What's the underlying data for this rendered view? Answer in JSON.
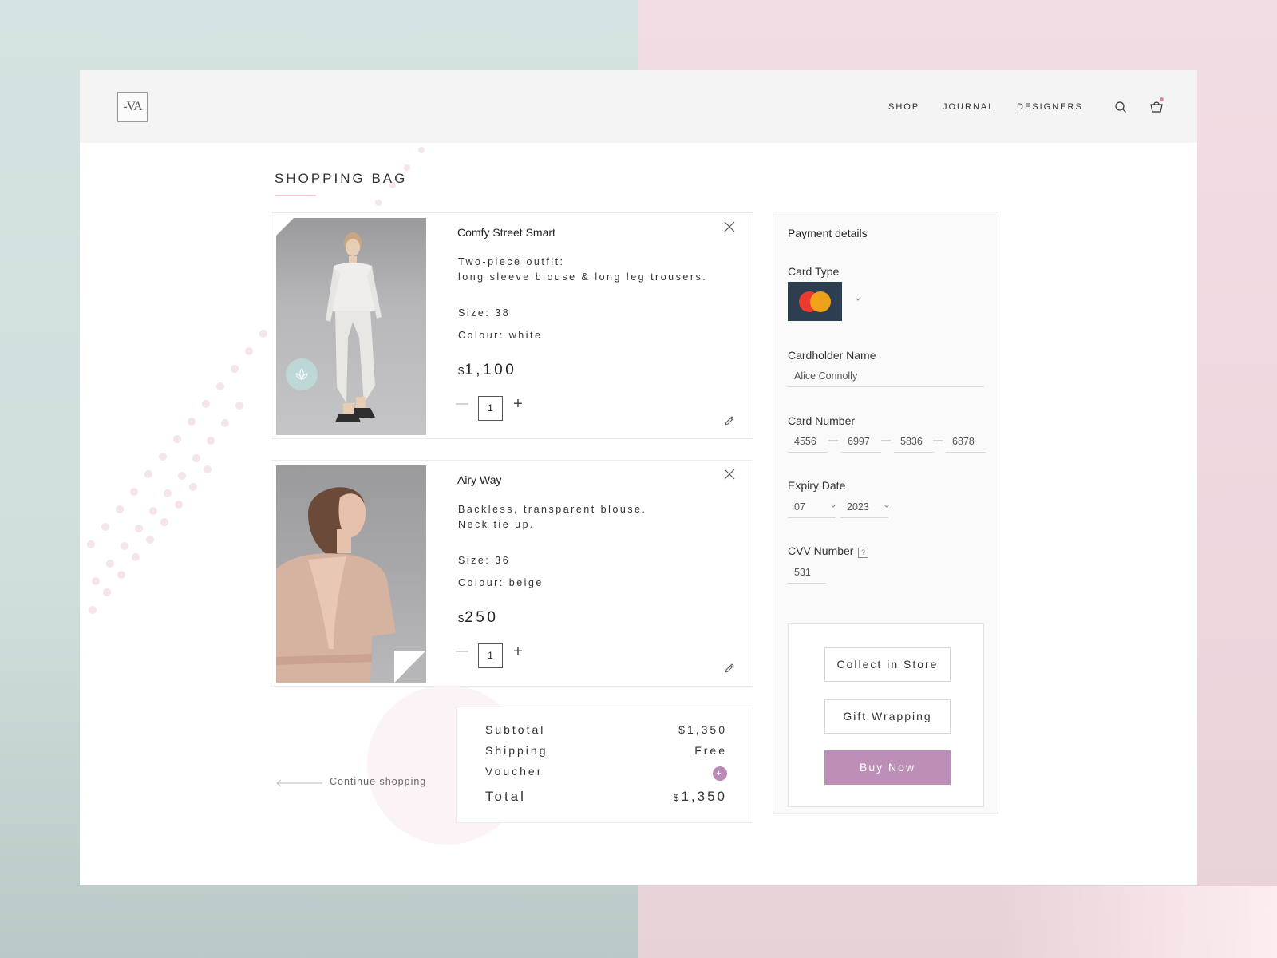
{
  "brand": {
    "logo_text": "-VA"
  },
  "nav": {
    "shop": "SHOP",
    "journal": "JOURNAL",
    "designers": "DESIGNERS"
  },
  "page": {
    "title": "SHOPPING BAG"
  },
  "items": [
    {
      "name": "Comfy Street Smart",
      "description": "Two-piece outfit:\nlong sleeve blouse & long leg trousers.",
      "size": "Size: 38",
      "colour": "Colour: white",
      "currency": "$",
      "price": "1,100",
      "quantity": "1"
    },
    {
      "name": "Airy Way",
      "description": "Backless, transparent blouse.\nNeck tie up.",
      "size": "Size: 36",
      "colour": "Colour: beige",
      "currency": "$",
      "price": "250",
      "quantity": "1"
    }
  ],
  "summary": {
    "subtotal_label": "Subtotal",
    "subtotal_value": "$1,350",
    "shipping_label": "Shipping",
    "shipping_value": "Free",
    "voucher_label": "Voucher",
    "voucher_button": "+",
    "total_label": "Total",
    "total_currency": "$",
    "total_value": "1,350"
  },
  "continue_shopping": "Continue shopping",
  "payment": {
    "title": "Payment details",
    "card_type_label": "Card Type",
    "card_type_selected": "mastercard",
    "cardholder_label": "Cardholder Name",
    "cardholder_value": "Alice Connolly",
    "card_number_label": "Card Number",
    "card_number": [
      "4556",
      "6997",
      "5836",
      "6878"
    ],
    "number_separator": "—",
    "expiry_label": "Expiry Date",
    "expiry_month": "07",
    "expiry_year": "2023",
    "cvv_label": "CVV Number",
    "cvv_help": "?",
    "cvv_value": "531"
  },
  "options": {
    "collect": "Collect in Store",
    "gift": "Gift Wrapping",
    "buy": "Buy Now"
  },
  "colors": {
    "accent": "#bd8fb8",
    "underline": "#f0c5d2",
    "bag_dot": "#ee7ba8",
    "card_bg": "#2c3e50"
  }
}
